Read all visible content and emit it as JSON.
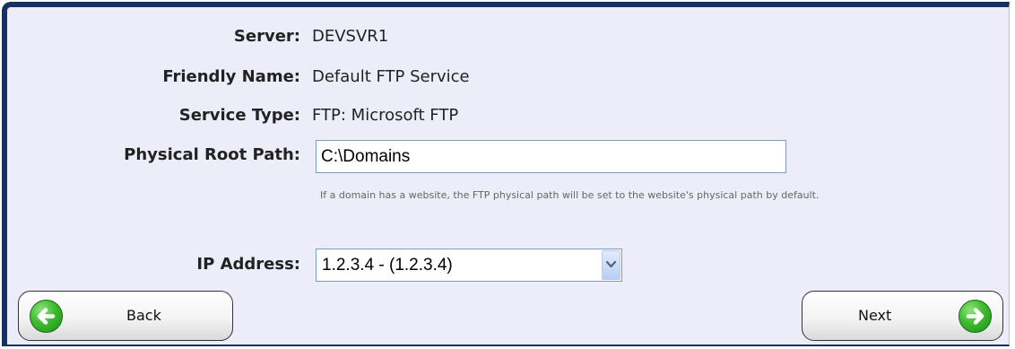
{
  "form": {
    "server_label": "Server:",
    "server_value": "DEVSVR1",
    "friendly_name_label": "Friendly Name:",
    "friendly_name_value": "Default FTP Service",
    "service_type_label": "Service Type:",
    "service_type_value": "FTP: Microsoft FTP",
    "physical_root_path_label": "Physical Root Path:",
    "physical_root_path_value": "C:\\Domains",
    "physical_root_path_hint": "If a domain has a website, the FTP physical path will be set to the website's physical path by default.",
    "ip_address_label": "IP Address:",
    "ip_address_selected": "1.2.3.4 - (1.2.3.4)"
  },
  "nav": {
    "back_label": "Back",
    "next_label": "Next"
  },
  "colors": {
    "panel_background": "#ecedf9",
    "frame": "#17325f",
    "arrow_button": "#3dbb2e"
  }
}
